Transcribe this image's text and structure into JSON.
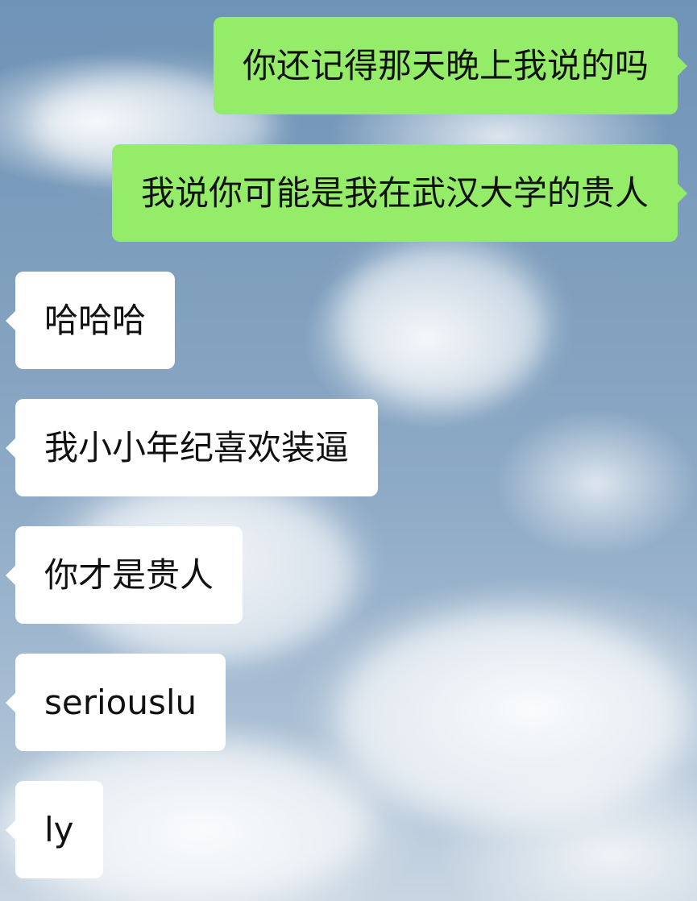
{
  "chat": {
    "messages": [
      {
        "direction": "out",
        "text": "你还记得那天晚上我说的吗"
      },
      {
        "direction": "out",
        "text": "我说你可能是我在武汉大学的贵人"
      },
      {
        "direction": "in",
        "text": "哈哈哈"
      },
      {
        "direction": "in",
        "text": "我小小年纪喜欢装逼"
      },
      {
        "direction": "in",
        "text": "你才是贵人"
      },
      {
        "direction": "in",
        "text": "seriouslu"
      },
      {
        "direction": "in",
        "text": "ly"
      }
    ]
  },
  "colors": {
    "outgoing_bubble": "#95ec69",
    "incoming_bubble": "#ffffff",
    "text": "#111111"
  }
}
